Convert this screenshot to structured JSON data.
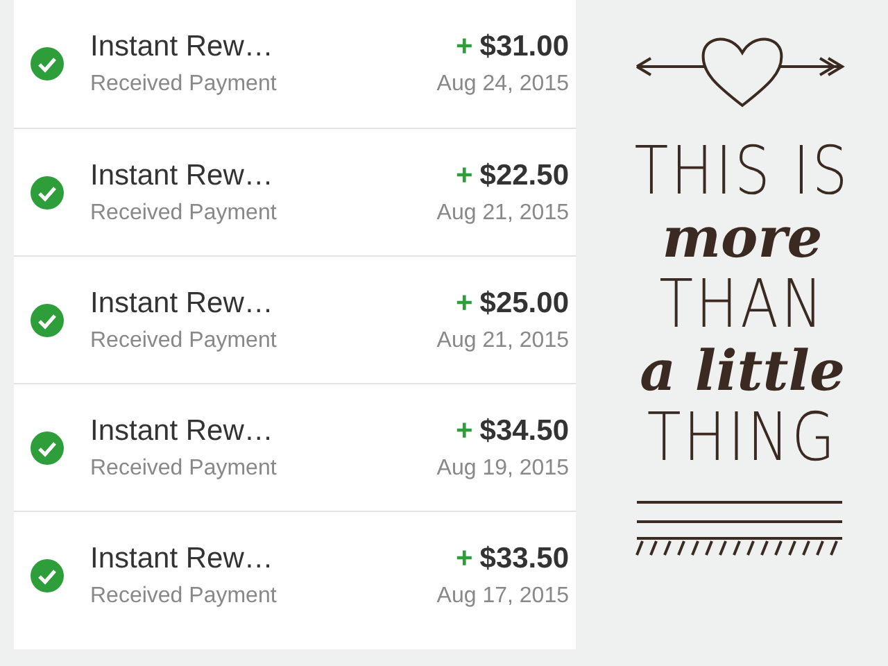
{
  "transactions": [
    {
      "title": "Instant Rew…",
      "subtitle": "Received Payment",
      "sign": "+",
      "amount": "$31.00",
      "date": "Aug 24, 2015"
    },
    {
      "title": "Instant Rew…",
      "subtitle": "Received Payment",
      "sign": "+",
      "amount": "$22.50",
      "date": "Aug 21, 2015"
    },
    {
      "title": "Instant Rew…",
      "subtitle": "Received Payment",
      "sign": "+",
      "amount": "$25.00",
      "date": "Aug 21, 2015"
    },
    {
      "title": "Instant Rew…",
      "subtitle": "Received Payment",
      "sign": "+",
      "amount": "$34.50",
      "date": "Aug 19, 2015"
    },
    {
      "title": "Instant Rew…",
      "subtitle": "Received Payment",
      "sign": "+",
      "amount": "$33.50",
      "date": "Aug 17, 2015"
    }
  ],
  "poster": {
    "lines": [
      {
        "text": "THIS IS",
        "kind": "caps"
      },
      {
        "text": "more",
        "kind": "script"
      },
      {
        "text": "THAN",
        "kind": "caps"
      },
      {
        "text": "a little",
        "kind": "script"
      },
      {
        "text": "THING",
        "kind": "caps"
      }
    ]
  }
}
